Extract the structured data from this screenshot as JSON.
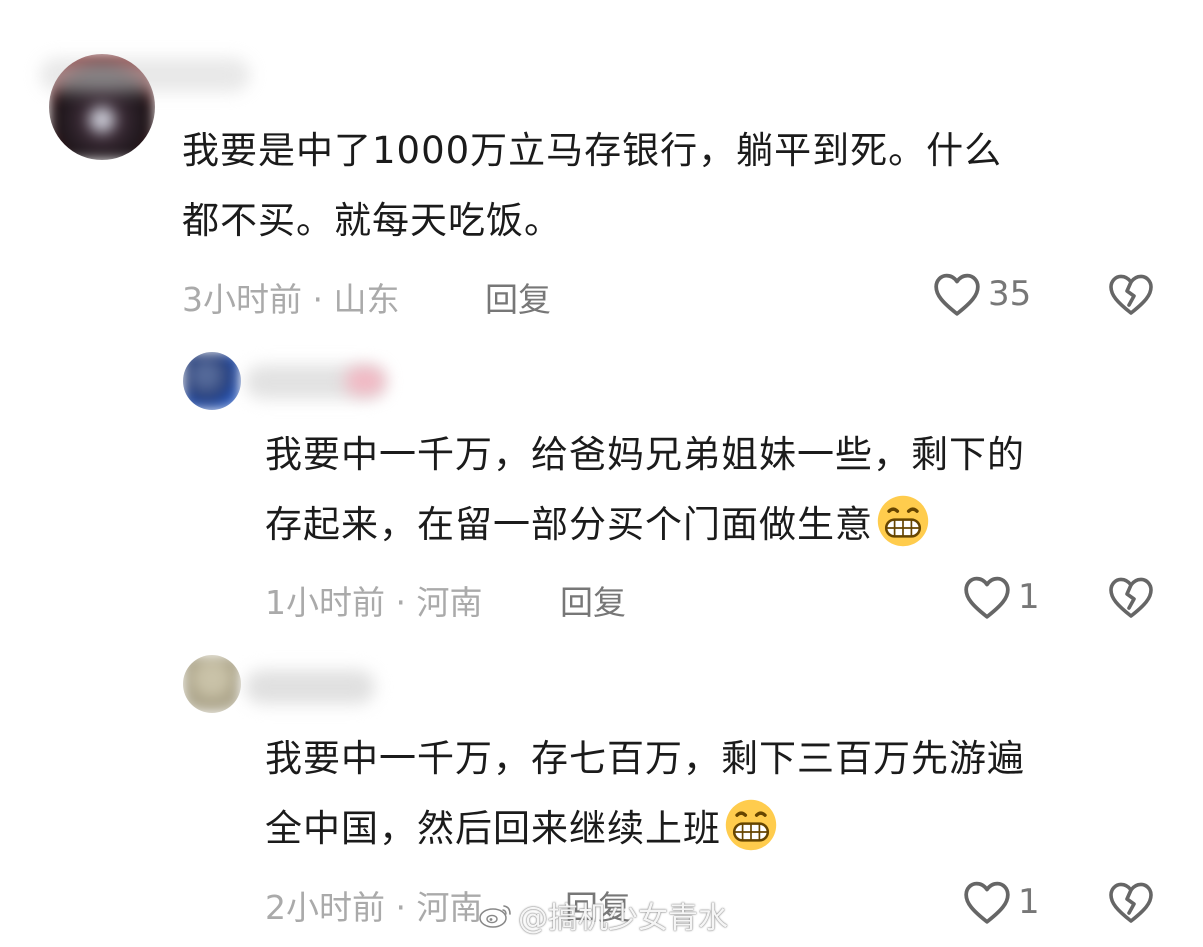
{
  "comments": [
    {
      "text_lines": [
        "我要是中了1000万立马存银行，躺平到死。什么",
        "都不买。就每天吃饭。"
      ],
      "time": "3小时前",
      "location": "山东",
      "reply_label": "回复",
      "likes": "35"
    },
    {
      "text_lines": [
        "我要中一千万，给爸妈兄弟姐妹一些，剩下的",
        "存起来，在留一部分买个门面做生意"
      ],
      "time": "1小时前",
      "location": "河南",
      "reply_label": "回复",
      "likes": "1"
    },
    {
      "text_lines": [
        "我要中一千万，存七百万，剩下三百万先游遍",
        "全中国，然后回来继续上班"
      ],
      "time": "2小时前",
      "location": "河南",
      "reply_label": "回复",
      "likes": "1"
    }
  ],
  "separator": " · ",
  "watermark": "@搞机少女青水",
  "icons": {
    "like": "heart-outline-icon",
    "dislike": "broken-heart-icon",
    "emoji": "grinning-face-emoji",
    "watermark_logo": "weibo-logo-icon"
  },
  "colors": {
    "text": "#1b1b1b",
    "meta": "#aaaaaa",
    "reply": "#777777",
    "icon": "#666666"
  }
}
